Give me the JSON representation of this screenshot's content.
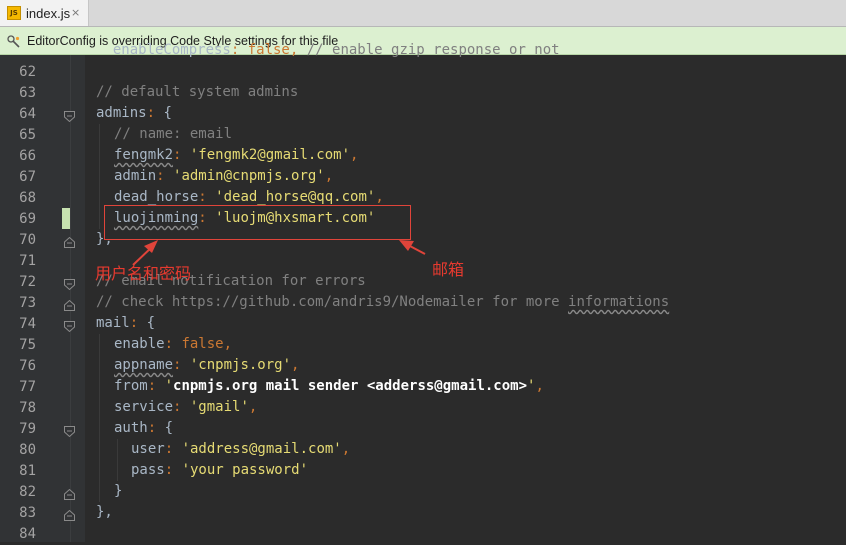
{
  "tab": {
    "file_name": "index.js",
    "icon": "js-file-icon",
    "close": "×",
    "badge": "JS"
  },
  "notification": {
    "text": "EditorConfig is overriding Code Style settings for this file"
  },
  "lines": [
    {
      "n": "62",
      "text": "  enableCompress: false, // enable gzip response or not"
    },
    {
      "n": "63",
      "text": ""
    },
    {
      "n": "64",
      "text": ""
    },
    {
      "n": "65",
      "text": ""
    },
    {
      "n": "66",
      "text": ""
    },
    {
      "n": "67",
      "text": ""
    },
    {
      "n": "68",
      "text": ""
    },
    {
      "n": "69",
      "text": ""
    },
    {
      "n": "70",
      "text": ""
    },
    {
      "n": "71",
      "text": ""
    },
    {
      "n": "72",
      "text": ""
    },
    {
      "n": "73",
      "text": ""
    },
    {
      "n": "74",
      "text": ""
    },
    {
      "n": "75",
      "text": ""
    },
    {
      "n": "76",
      "text": ""
    },
    {
      "n": "77",
      "text": ""
    },
    {
      "n": "78",
      "text": ""
    },
    {
      "n": "79",
      "text": ""
    },
    {
      "n": "80",
      "text": ""
    },
    {
      "n": "81",
      "text": ""
    },
    {
      "n": "82",
      "text": ""
    },
    {
      "n": "83",
      "text": ""
    },
    {
      "n": "84",
      "text": ""
    }
  ],
  "code": {
    "l63_comment": "// default system admins",
    "l64_key": "admins",
    "l65_comment": "// name: email",
    "l66_key": "fengmk2",
    "l66_val": "'fengmk2@gmail.com'",
    "l67_key": "admin",
    "l67_val": "'admin@cnpmjs.org'",
    "l68_key": "dead_horse",
    "l68_val": "'dead_horse@qq.com'",
    "l69_key": "luojinming",
    "l69_val": "'luojm@hxsmart.com'",
    "l70": "},",
    "l72_comment": "// email notification for errors",
    "l73_comment_a": "// check https://github.com/andris9/Nodemailer for more ",
    "l73_comment_b": "informations",
    "l74_key": "mail",
    "l75_key": "enable",
    "l75_val": "false",
    "l76_key": "appname",
    "l76_val": "'cnpmjs.org'",
    "l77_key": "from",
    "l77_val_a": "'",
    "l77_val_b": "cnpmjs.org mail sender <adderss@gmail.com>",
    "l77_val_c": "'",
    "l78_key": "service",
    "l78_val": "'gmail'",
    "l79_key": "auth",
    "l80_key": "user",
    "l80_val": "'address@gmail.com'",
    "l81_key": "pass",
    "l81_val": "'your password'",
    "l82": "}",
    "l83": "},"
  },
  "annotations": {
    "username_password": "用户名和密码",
    "email": "邮箱"
  }
}
